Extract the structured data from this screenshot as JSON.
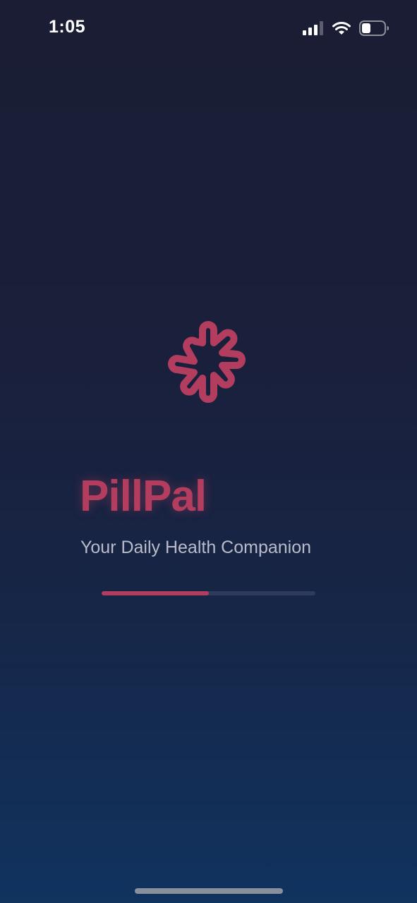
{
  "status_bar": {
    "time": "1:05",
    "icons": [
      "signal-icon",
      "wifi-icon",
      "battery-icon"
    ],
    "battery_level": 0.4
  },
  "splash": {
    "logo_icon": "asterisk-logo-icon",
    "app_name": "PillPal",
    "tagline": "Your Daily Health Companion",
    "loading_progress": 0.5
  },
  "colors": {
    "background_top": "#1a1d33",
    "background_bottom": "#10335f",
    "accent": "#b33d5e",
    "tagline": "#b8bccb",
    "progress_track": "#2e3a5e"
  }
}
